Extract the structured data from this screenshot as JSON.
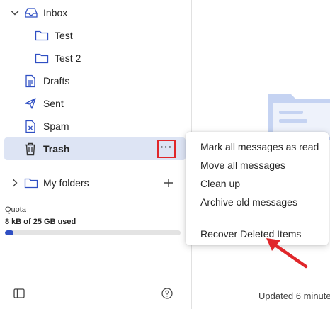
{
  "sidebar": {
    "inbox": "Inbox",
    "test": "Test",
    "test2": "Test 2",
    "drafts": "Drafts",
    "sent": "Sent",
    "spam": "Spam",
    "trash": "Trash",
    "my_folders": "My folders",
    "more_button": "···"
  },
  "quota": {
    "title": "Quota",
    "used_text": "8 kB of 25 GB used",
    "used_fraction": 0.0003
  },
  "context_menu": {
    "items": [
      "Mark all messages as read",
      "Move all messages",
      "Clean up",
      "Archive old messages"
    ],
    "recover": "Recover Deleted Items"
  },
  "status": {
    "updated": "Updated 6 minute"
  },
  "colors": {
    "selected_bg": "#dde4f4",
    "accent": "#2f4fc3",
    "highlight_red": "#e0262a"
  }
}
